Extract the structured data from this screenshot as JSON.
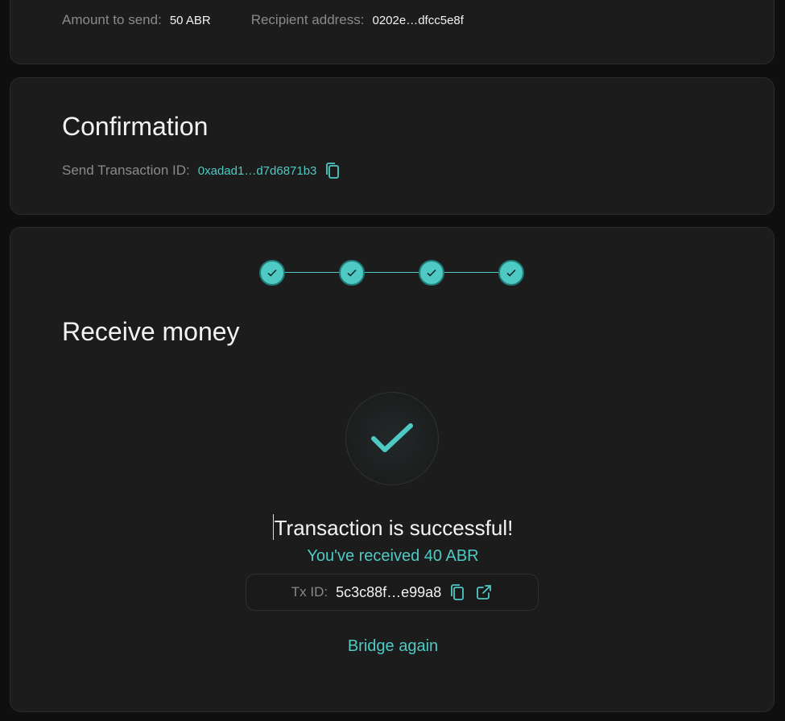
{
  "summary": {
    "amount_label": "Amount to send:",
    "amount_value": "50 ABR",
    "recipient_label": "Recipient address:",
    "recipient_value": "0202e…dfcc5e8f"
  },
  "confirmation": {
    "title": "Confirmation",
    "send_tx_label": "Send Transaction ID:",
    "send_tx_value": "0xadad1…d7d6871b3"
  },
  "receive": {
    "title": "Receive money",
    "steps_completed": 4,
    "steps_total": 4,
    "success_title": "Transaction is successful!",
    "received_text": "You've received 40 ABR",
    "tx_label": "Tx ID:",
    "tx_value": "5c3c88f…e99a8",
    "bridge_again_label": "Bridge again"
  },
  "colors": {
    "accent": "#4fc9c4",
    "card_bg": "#1c1c1c",
    "page_bg": "#0f0f0f"
  },
  "icons": [
    "copy-icon",
    "external-link-icon",
    "check-icon"
  ]
}
